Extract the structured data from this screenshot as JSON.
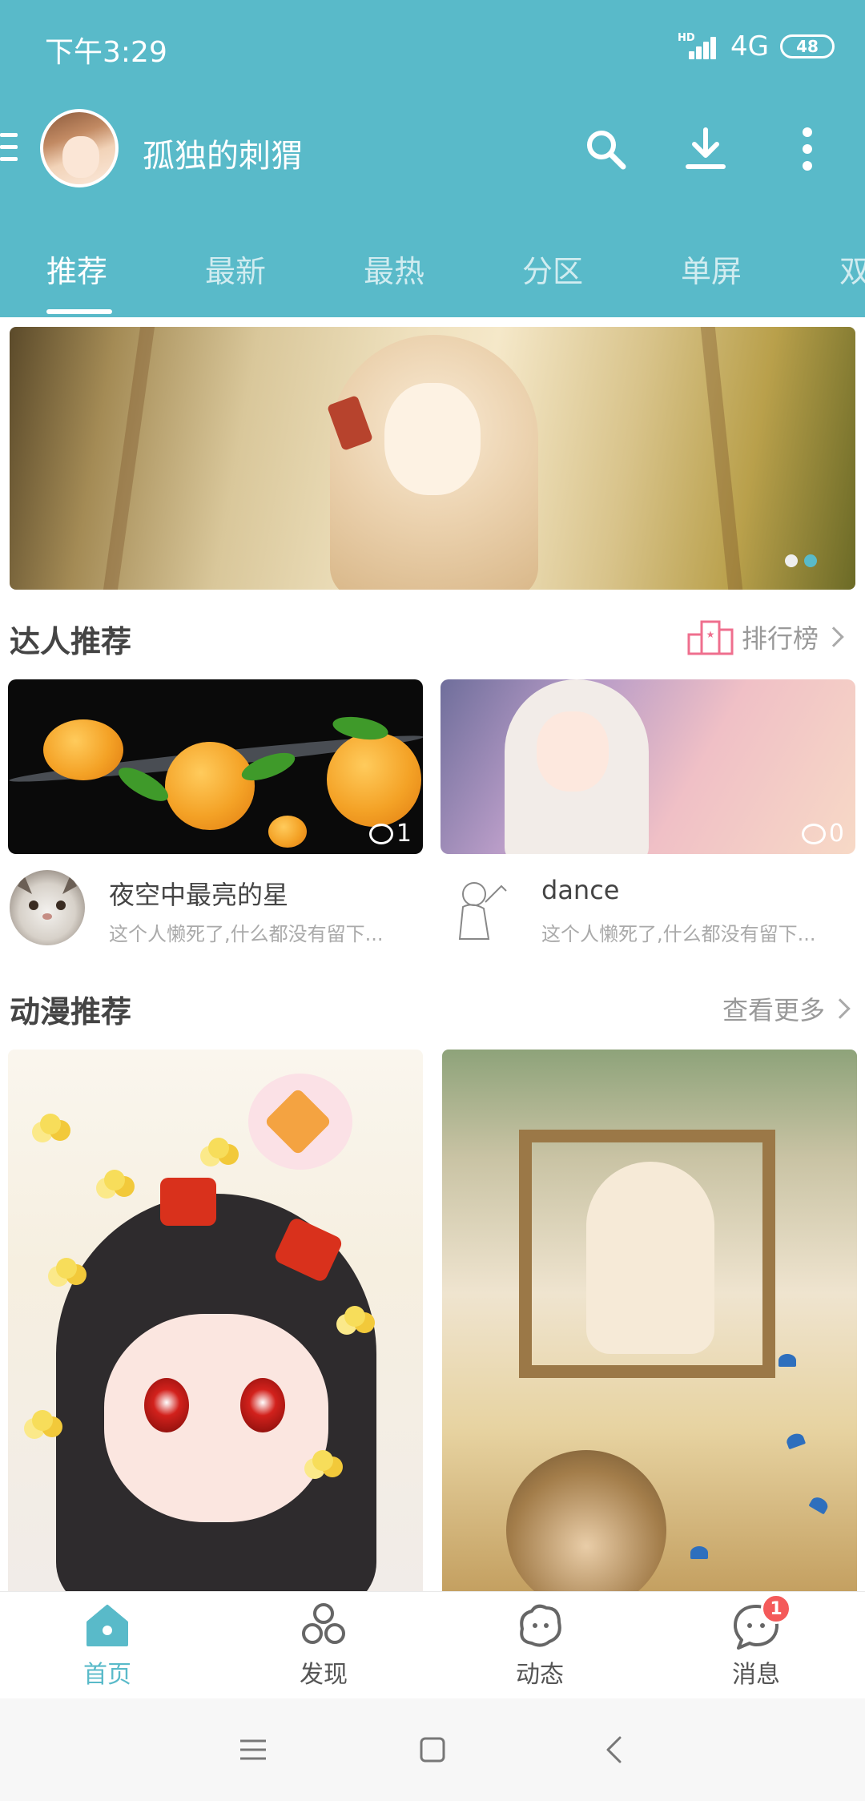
{
  "statusbar": {
    "time": "下午3:29",
    "network_hd": "HD",
    "network": "4G",
    "battery": "48"
  },
  "appbar": {
    "username": "孤独的刺猬"
  },
  "tabs": [
    "推荐",
    "最新",
    "最热",
    "分区",
    "单屏",
    "双"
  ],
  "banner": {
    "page_count": 2,
    "active_page": 2
  },
  "experts": {
    "title": "达人推荐",
    "link_label": "排行榜",
    "cards": [
      {
        "comments": "1",
        "name": "夜空中最亮的星",
        "desc": "这个人懒死了,什么都没有留下..."
      },
      {
        "comments": "0",
        "name": "dance",
        "desc": "这个人懒死了,什么都没有留下..."
      }
    ]
  },
  "anime": {
    "title": "动漫推荐",
    "link_label": "查看更多"
  },
  "bottom_nav": {
    "items": [
      {
        "label": "首页",
        "icon": "home-icon"
      },
      {
        "label": "发现",
        "icon": "discover-icon"
      },
      {
        "label": "动态",
        "icon": "feed-icon"
      },
      {
        "label": "消息",
        "icon": "message-icon"
      }
    ],
    "message_badge": "1"
  },
  "colors": {
    "accent": "#59bac9",
    "badge": "#f45a5a",
    "ranking_icon": "#ef6f8e"
  }
}
